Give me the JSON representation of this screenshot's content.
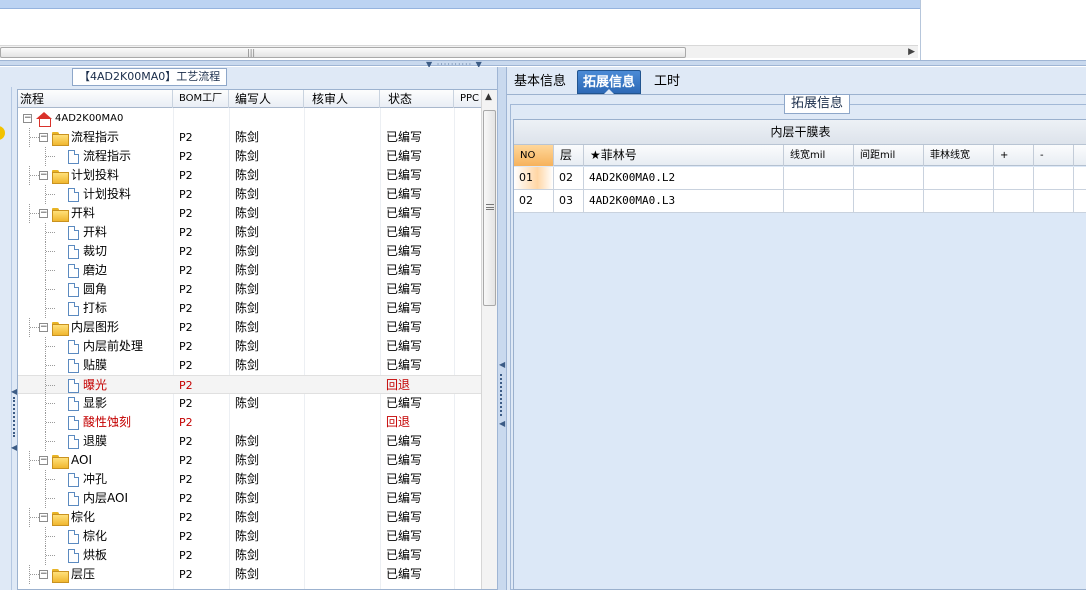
{
  "top": {
    "hscroll_grip": "|||",
    "hscroll_right_arrow": "▶"
  },
  "splitter": {
    "grip": "▼ ·········· ▼"
  },
  "left": {
    "legend_title": "【4AD2K00MA0】工艺流程",
    "columns": [
      "流程",
      "BOM工厂",
      "编写人",
      "核审人",
      "状态",
      "PPC"
    ],
    "rows": [
      {
        "level": 0,
        "type": "root",
        "name": "4AD2K00MA0",
        "bom": "",
        "writer": "",
        "status": "",
        "expand": "−"
      },
      {
        "level": 1,
        "type": "folder",
        "name": "流程指示",
        "bom": "P2",
        "writer": "陈剑",
        "status": "已编写",
        "expand": "−"
      },
      {
        "level": 2,
        "type": "doc",
        "name": "流程指示",
        "bom": "P2",
        "writer": "陈剑",
        "status": "已编写"
      },
      {
        "level": 1,
        "type": "folder",
        "name": "计划投料",
        "bom": "P2",
        "writer": "陈剑",
        "status": "已编写",
        "expand": "−"
      },
      {
        "level": 2,
        "type": "doc",
        "name": "计划投料",
        "bom": "P2",
        "writer": "陈剑",
        "status": "已编写"
      },
      {
        "level": 1,
        "type": "folder",
        "name": "开料",
        "bom": "P2",
        "writer": "陈剑",
        "status": "已编写",
        "expand": "−"
      },
      {
        "level": 2,
        "type": "doc",
        "name": "开料",
        "bom": "P2",
        "writer": "陈剑",
        "status": "已编写"
      },
      {
        "level": 2,
        "type": "doc",
        "name": "裁切",
        "bom": "P2",
        "writer": "陈剑",
        "status": "已编写"
      },
      {
        "level": 2,
        "type": "doc",
        "name": "磨边",
        "bom": "P2",
        "writer": "陈剑",
        "status": "已编写"
      },
      {
        "level": 2,
        "type": "doc",
        "name": "圆角",
        "bom": "P2",
        "writer": "陈剑",
        "status": "已编写"
      },
      {
        "level": 2,
        "type": "doc",
        "name": "打标",
        "bom": "P2",
        "writer": "陈剑",
        "status": "已编写"
      },
      {
        "level": 1,
        "type": "folder",
        "name": "内层图形",
        "bom": "P2",
        "writer": "陈剑",
        "status": "已编写",
        "expand": "−"
      },
      {
        "level": 2,
        "type": "doc",
        "name": "内层前处理",
        "bom": "P2",
        "writer": "陈剑",
        "status": "已编写"
      },
      {
        "level": 2,
        "type": "doc",
        "name": "贴膜",
        "bom": "P2",
        "writer": "陈剑",
        "status": "已编写"
      },
      {
        "level": 2,
        "type": "doc",
        "name": "曝光",
        "bom": "P2",
        "writer": "",
        "status": "回退",
        "red": true,
        "selected": true
      },
      {
        "level": 2,
        "type": "doc",
        "name": "显影",
        "bom": "P2",
        "writer": "陈剑",
        "status": "已编写"
      },
      {
        "level": 2,
        "type": "doc",
        "name": "酸性蚀刻",
        "bom": "P2",
        "writer": "",
        "status": "回退",
        "red": true
      },
      {
        "level": 2,
        "type": "doc",
        "name": "退膜",
        "bom": "P2",
        "writer": "陈剑",
        "status": "已编写"
      },
      {
        "level": 1,
        "type": "folder",
        "name": "AOI",
        "bom": "P2",
        "writer": "陈剑",
        "status": "已编写",
        "expand": "−"
      },
      {
        "level": 2,
        "type": "doc",
        "name": "冲孔",
        "bom": "P2",
        "writer": "陈剑",
        "status": "已编写"
      },
      {
        "level": 2,
        "type": "doc",
        "name": "内层AOI",
        "bom": "P2",
        "writer": "陈剑",
        "status": "已编写"
      },
      {
        "level": 1,
        "type": "folder",
        "name": "棕化",
        "bom": "P2",
        "writer": "陈剑",
        "status": "已编写",
        "expand": "−"
      },
      {
        "level": 2,
        "type": "doc",
        "name": "棕化",
        "bom": "P2",
        "writer": "陈剑",
        "status": "已编写"
      },
      {
        "level": 2,
        "type": "doc",
        "name": "烘板",
        "bom": "P2",
        "writer": "陈剑",
        "status": "已编写"
      },
      {
        "level": 1,
        "type": "folder",
        "name": "层压",
        "bom": "P2",
        "writer": "陈剑",
        "status": "已编写",
        "expand": "−"
      }
    ]
  },
  "right": {
    "tabs": [
      {
        "label": "基本信息",
        "active": false
      },
      {
        "label": "拓展信息",
        "active": true
      },
      {
        "label": "工时",
        "active": false
      }
    ],
    "group_title": "拓展信息",
    "grid": {
      "title": "内层干膜表",
      "columns": [
        "NO",
        "层",
        "★菲林号",
        "线宽mil",
        "间距mil",
        "菲林线宽",
        "+",
        "-"
      ],
      "rows": [
        {
          "no": "01",
          "layer": "02",
          "film": "4AD2K00MA0.L2",
          "highlight": true
        },
        {
          "no": "02",
          "layer": "03",
          "film": "4AD2K00MA0.L3",
          "highlight": false
        }
      ]
    }
  },
  "colors": {
    "panel_bg": "#dfe9f6",
    "active_tab": "#2d69b6",
    "rollback_red": "#c40000",
    "no_header": "#f6b25c"
  }
}
